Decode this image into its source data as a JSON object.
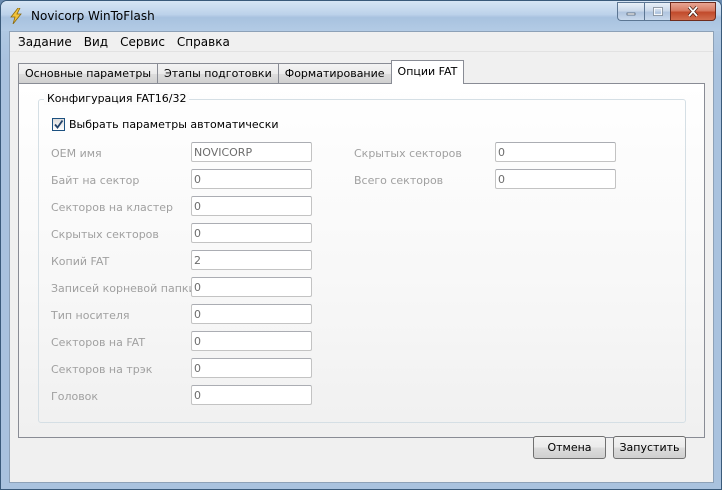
{
  "window": {
    "title": "Novicorp WinToFlash"
  },
  "menu": [
    "Задание",
    "Вид",
    "Сервис",
    "Справка"
  ],
  "tabs": [
    {
      "label": "Основные параметры",
      "active": false
    },
    {
      "label": "Этапы подготовки",
      "active": false
    },
    {
      "label": "Форматирование",
      "active": false
    },
    {
      "label": "Опции FAT",
      "active": true
    }
  ],
  "group": {
    "title": "Конфигурация FAT16/32",
    "auto_checkbox": {
      "label": "Выбрать параметры автоматически",
      "checked": true
    },
    "left_fields": [
      {
        "label": "OEM имя",
        "value": "NOVICORP"
      },
      {
        "label": "Байт на сектор",
        "value": "0"
      },
      {
        "label": "Секторов на кластер",
        "value": "0"
      },
      {
        "label": "Скрытых секторов",
        "value": "0"
      },
      {
        "label": "Копий FAT",
        "value": "2"
      },
      {
        "label": "Записей корневой папки",
        "value": "0"
      },
      {
        "label": "Тип носителя",
        "value": "0"
      },
      {
        "label": "Секторов на FAT",
        "value": "0"
      },
      {
        "label": "Секторов на трэк",
        "value": "0"
      },
      {
        "label": "Головок",
        "value": "0"
      }
    ],
    "right_fields": [
      {
        "label": "Скрытых секторов",
        "value": "0"
      },
      {
        "label": "Всего секторов",
        "value": "0"
      }
    ]
  },
  "buttons": {
    "cancel": "Отмена",
    "run": "Запустить"
  }
}
